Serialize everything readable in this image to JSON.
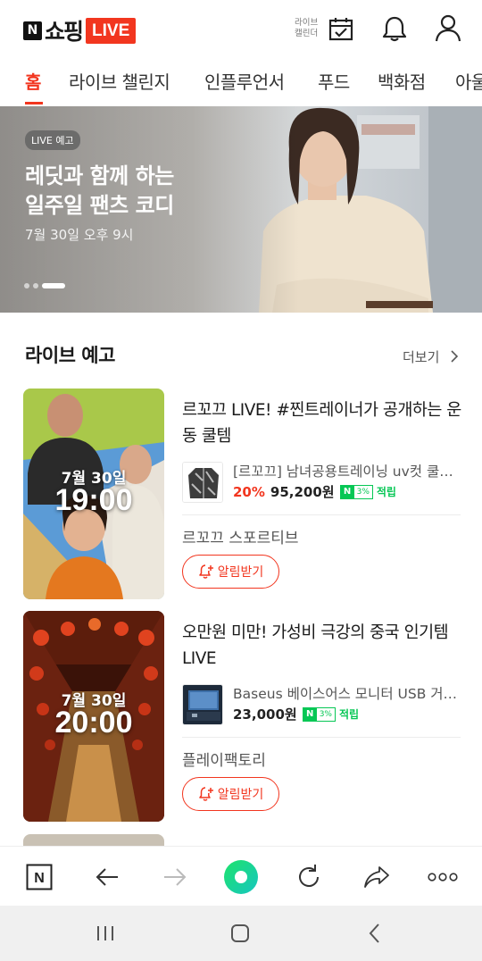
{
  "header": {
    "logo_n": "N",
    "logo_text": "쇼핑",
    "logo_live": "LIVE",
    "calendar_label_line1": "라이브",
    "calendar_label_line2": "캘린더"
  },
  "tabs": [
    {
      "label": "홈",
      "active": true
    },
    {
      "label": "라이브 챌린지",
      "active": false
    },
    {
      "label": "인플루언서",
      "active": false
    },
    {
      "label": "푸드",
      "active": false
    },
    {
      "label": "백화점",
      "active": false
    },
    {
      "label": "아울",
      "active": false
    }
  ],
  "banner": {
    "badge": "LIVE 예고",
    "title_line1": "레딧과 함께 하는",
    "title_line2": "일주일 팬츠 코디",
    "date": "7월 30일 오후 9시",
    "slide_count": 3,
    "active_slide": 3
  },
  "section": {
    "title": "라이브 예고",
    "more_label": "더보기"
  },
  "cards": [
    {
      "thumb_date": "7월 30일",
      "thumb_time": "19:00",
      "title": "르꼬끄 LIVE! #찐트레이너가 공개하는 운동 쿨템",
      "product_name": "[르꼬끄] 남녀공용트레이닝 uv컷 쿨…",
      "discount": "20%",
      "price": "95,200원",
      "npay_n": "N",
      "npay_pct": "3%",
      "points_label": "적립",
      "seller": "르꼬끄 스포르티브",
      "alarm_label": "알림받기"
    },
    {
      "thumb_date": "7월 30일",
      "thumb_time": "20:00",
      "title": "오만원 미만! 가성비 극강의 중국 인기템 LIVE",
      "product_name": "Baseus 베이스어스 모니터 USB 거…",
      "discount": "",
      "price": "23,000원",
      "npay_n": "N",
      "npay_pct": "3%",
      "points_label": "적립",
      "seller": "플레이팩토리",
      "alarm_label": "알림받기"
    }
  ],
  "bottom_bar": {
    "items": [
      "naver-home-icon",
      "back-arrow-icon",
      "forward-arrow-icon",
      "green-dot-icon",
      "refresh-icon",
      "share-icon",
      "more-icon"
    ],
    "n_label": "N"
  },
  "colors": {
    "accent": "#f2361f",
    "npay_green": "#06c755"
  }
}
